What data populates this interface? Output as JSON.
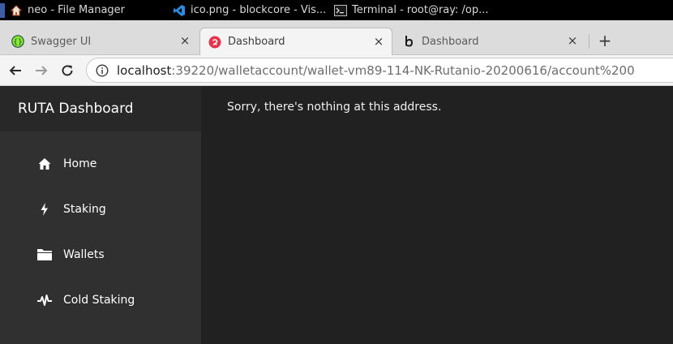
{
  "taskbar": {
    "tasks": [
      {
        "label": "neo - File Manager",
        "icon": "home-folder-icon"
      },
      {
        "label": "ico.png - blockcore - Vis...",
        "icon": "vscode-icon"
      },
      {
        "label": "Terminal - root@ray: /op...",
        "icon": "terminal-icon"
      }
    ]
  },
  "browser": {
    "tabs": [
      {
        "title": "Swagger UI",
        "icon": "swagger-icon",
        "active": false
      },
      {
        "title": "Dashboard",
        "icon": "dashboard-favicon-icon",
        "active": true
      },
      {
        "title": "Dashboard",
        "icon": "blockcore-favicon-icon",
        "active": false
      }
    ],
    "new_tab_label": "+",
    "close_label": "×",
    "url": {
      "host": "localhost",
      "rest": ":39220/walletaccount/wallet-vm89-114-NK-Rutanio-20200616/account%200"
    }
  },
  "app": {
    "brand": "RUTA Dashboard",
    "nav": [
      {
        "label": "Home",
        "icon": "home-icon"
      },
      {
        "label": "Staking",
        "icon": "lightning-icon"
      },
      {
        "label": "Wallets",
        "icon": "folder-icon"
      },
      {
        "label": "Cold Staking",
        "icon": "pulse-icon"
      }
    ],
    "message": "Sorry, there's nothing at this address."
  },
  "colors": {
    "sidebar_bg": "#303030",
    "brand_bg": "#282828",
    "content_bg": "#212121",
    "dashboard_favicon": "#e8334a",
    "swagger_green": "#85ea2d"
  }
}
